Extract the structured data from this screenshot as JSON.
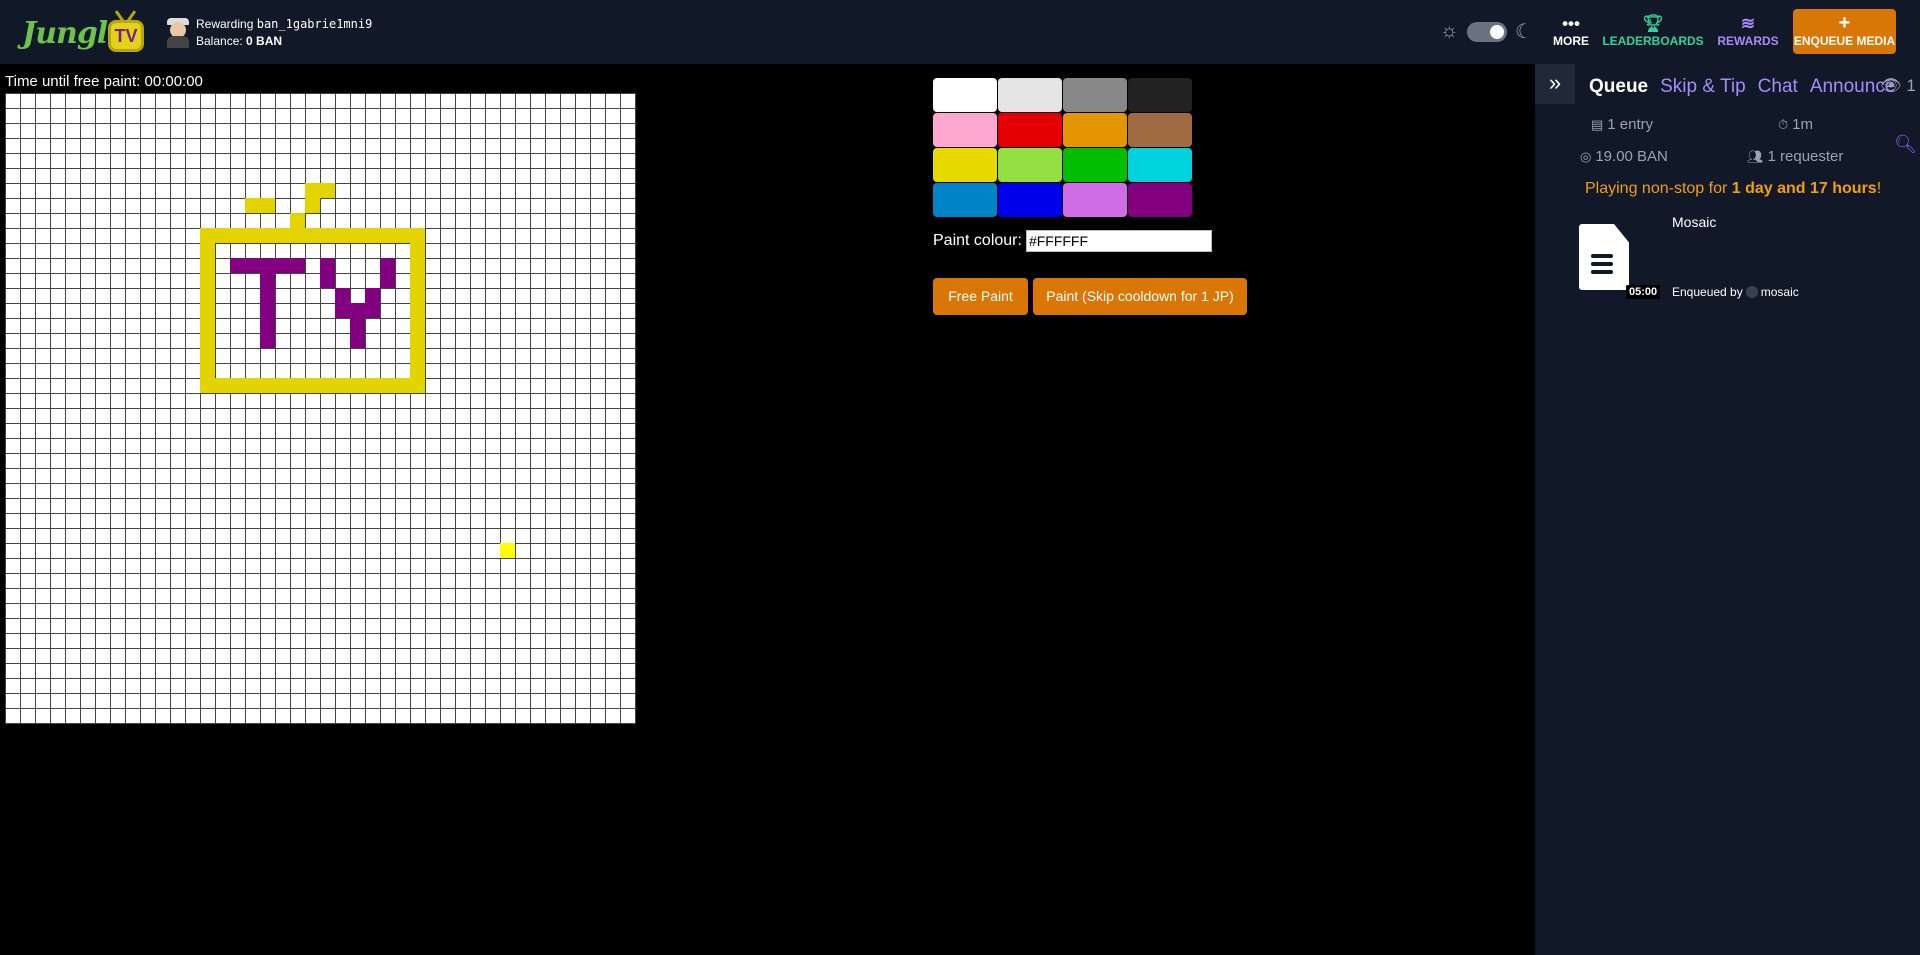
{
  "header": {
    "logo_text": "Jungle",
    "logo_tv": "TV",
    "reward_prefix": "Rewarding",
    "reward_address": "ban_1gabrie1mni9",
    "balance_label": "Balance:",
    "balance_value": "0 BAN",
    "nav": {
      "more": "MORE",
      "leaderboards": "LEADERBOARDS",
      "rewards": "REWARDS",
      "enqueue": "ENQUEUE MEDIA"
    }
  },
  "canvas": {
    "timer_label": "Time until free paint: 00:00:00",
    "grid_cells": 42,
    "pixels": [
      {
        "color": "#e3d400",
        "col": 16,
        "row": 7,
        "w": 2,
        "h": 1
      },
      {
        "color": "#e3d400",
        "col": 20,
        "row": 6,
        "w": 2,
        "h": 1
      },
      {
        "color": "#e3d400",
        "col": 20,
        "row": 7,
        "w": 1,
        "h": 1
      },
      {
        "color": "#e3d400",
        "col": 19,
        "row": 8,
        "w": 1,
        "h": 1
      },
      {
        "color": "#e3d400",
        "col": 13,
        "row": 9,
        "w": 15,
        "h": 1
      },
      {
        "color": "#e3d400",
        "col": 13,
        "row": 19,
        "w": 15,
        "h": 1
      },
      {
        "color": "#e3d400",
        "col": 13,
        "row": 10,
        "w": 1,
        "h": 9
      },
      {
        "color": "#e3d400",
        "col": 27,
        "row": 10,
        "w": 1,
        "h": 9
      },
      {
        "color": "#820080",
        "col": 15,
        "row": 11,
        "w": 5,
        "h": 1
      },
      {
        "color": "#820080",
        "col": 17,
        "row": 12,
        "w": 1,
        "h": 5
      },
      {
        "color": "#820080",
        "col": 21,
        "row": 11,
        "w": 1,
        "h": 2
      },
      {
        "color": "#820080",
        "col": 25,
        "row": 11,
        "w": 1,
        "h": 2
      },
      {
        "color": "#820080",
        "col": 22,
        "row": 13,
        "w": 1,
        "h": 2
      },
      {
        "color": "#820080",
        "col": 24,
        "row": 13,
        "w": 1,
        "h": 2
      },
      {
        "color": "#820080",
        "col": 23,
        "row": 14,
        "w": 1,
        "h": 3
      },
      {
        "color": "#ffff00",
        "col": 33,
        "row": 30,
        "w": 1,
        "h": 1
      }
    ]
  },
  "palette": {
    "colors": [
      "#FFFFFF",
      "#E4E4E4",
      "#888888",
      "#222222",
      "#FFA7D1",
      "#E50000",
      "#E59500",
      "#A06A42",
      "#E5D900",
      "#94E044",
      "#02BE01",
      "#00D3DD",
      "#0083C7",
      "#0000EA",
      "#CF6EE4",
      "#820080"
    ],
    "paint_label": "Paint colour:",
    "paint_value": "#FFFFFF",
    "free_paint": "Free Paint",
    "skip_paint": "Paint (Skip cooldown for 1 JP)"
  },
  "sidebar": {
    "tabs": [
      "Queue",
      "Skip & Tip",
      "Chat",
      "Announce"
    ],
    "active_tab": "Queue",
    "viewers": "1",
    "stats": {
      "entries": "1 entry",
      "duration": "1m",
      "ban": "19.00 BAN",
      "requesters": "1 requester"
    },
    "playing_prefix": "Playing non-stop for ",
    "playing_duration": "1 day and 17 hours",
    "playing_suffix": "!",
    "queue": [
      {
        "title": "Mosaic",
        "length": "05:00",
        "enqueued_label": "Enqueued by",
        "user": "mosaic"
      }
    ]
  }
}
